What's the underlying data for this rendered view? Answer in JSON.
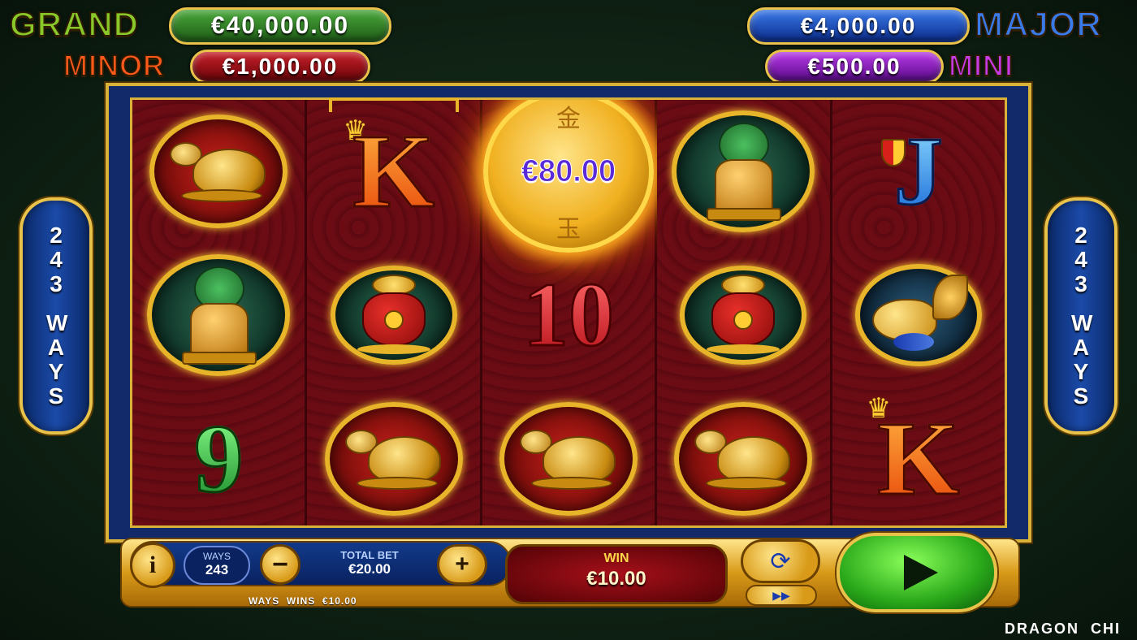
{
  "jackpots": {
    "grand": {
      "label": "GRAND",
      "value": "€40,000.00",
      "label_color": "#7ab82a",
      "box_color": "#2e7a22"
    },
    "major": {
      "label": "MAJOR",
      "value": "€4,000.00",
      "label_color": "#2a6ad8",
      "box_color": "#1a4ab8"
    },
    "minor": {
      "label": "MINOR",
      "value": "€1,000.00",
      "label_color": "#e8481a",
      "box_color": "#a8101a"
    },
    "mini": {
      "label": "MINI",
      "value": "€500.00",
      "label_color": "#a82ad8",
      "box_color": "#7a1aa8"
    }
  },
  "side_panels": {
    "left": {
      "num": "243",
      "text": "WAYS"
    },
    "right": {
      "num": "243",
      "text": "WAYS"
    }
  },
  "reels": [
    [
      "golden-turtle",
      "jade-lion",
      "green-9"
    ],
    [
      "orange-k",
      "money-bag",
      "golden-turtle"
    ],
    [
      "coin-bonus",
      "red-10",
      "golden-turtle"
    ],
    [
      "jade-lion",
      "money-bag",
      "golden-turtle"
    ],
    [
      "blue-j",
      "golden-fish",
      "orange-k"
    ]
  ],
  "symbols": {
    "green_9": "9",
    "orange_k": "K",
    "red_10": "10",
    "blue_j": "J",
    "coin_value": "€80.00",
    "coin_top_char": "金",
    "coin_bottom_char": "玉"
  },
  "controls": {
    "info_label": "i",
    "ways_label": "WAYS",
    "ways_value": "243",
    "minus_label": "−",
    "plus_label": "+",
    "total_bet_label": "TOTAL BET",
    "total_bet_value": "€20.00",
    "win_label": "WIN",
    "win_value": "€10.00",
    "ways_wins_text": "WAYS  WINS  €10.00",
    "autoplay_icon": "⟳",
    "turbo_icon": "▶▶"
  },
  "game_title": "DRAGON  CHI"
}
